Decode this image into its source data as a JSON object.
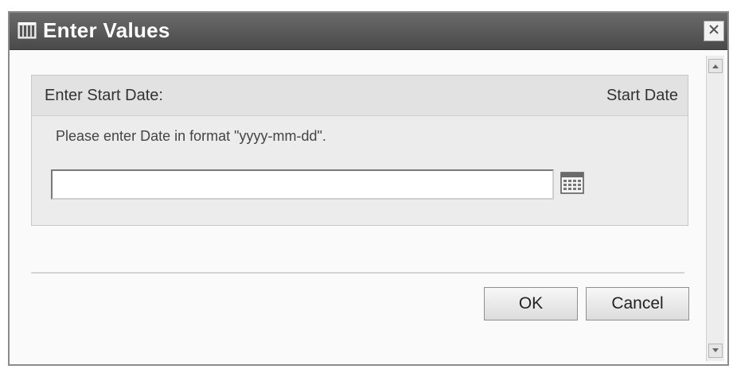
{
  "dialog": {
    "title": "Enter Values",
    "title_icon": "app-icon",
    "close_icon": "close-icon"
  },
  "prompt": {
    "title": "Enter Start Date:",
    "parameter_name": "Start Date",
    "instruction": "Please enter Date in format \"yyyy-mm-dd\".",
    "input_value": "",
    "calendar_icon": "calendar-icon"
  },
  "buttons": {
    "ok_label": "OK",
    "cancel_label": "Cancel"
  }
}
